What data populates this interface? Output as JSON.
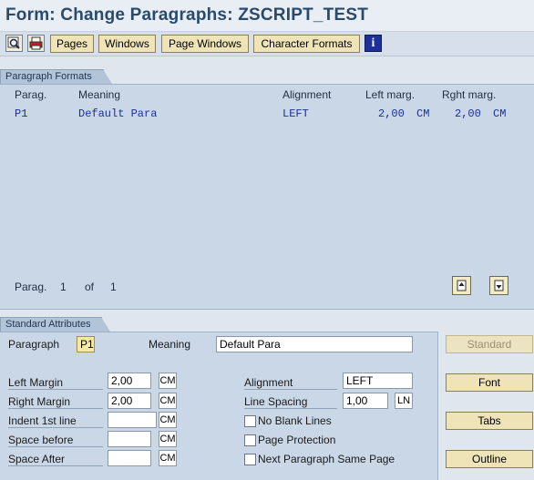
{
  "window": {
    "title": "Form: Change Paragraphs: ZSCRIPT_TEST"
  },
  "toolbar": {
    "icons": [
      "display-icon",
      "print-icon"
    ],
    "buttons": [
      "Pages",
      "Windows",
      "Page Windows",
      "Character Formats"
    ],
    "info_icon": "i"
  },
  "paragraph_formats": {
    "tab_label": "Paragraph Formats",
    "columns": [
      "Parag.",
      "Meaning",
      "Alignment",
      "Left marg.",
      "Rght marg."
    ],
    "rows": [
      {
        "parag": "P1",
        "meaning": "Default Para",
        "alignment": "LEFT",
        "left_marg": "2,00",
        "left_unit": "CM",
        "right_marg": "2,00",
        "right_unit": "CM"
      }
    ],
    "footer": {
      "label": "Parag.",
      "current": "1",
      "of_label": "of",
      "total": "1"
    }
  },
  "standard_attributes": {
    "tab_label": "Standard Attributes",
    "paragraph_label": "Paragraph",
    "paragraph_value": "P1",
    "meaning_label": "Meaning",
    "meaning_value": "Default Para",
    "left_margin_label": "Left Margin",
    "left_margin_value": "2,00",
    "left_margin_unit": "CM",
    "right_margin_label": "Right Margin",
    "right_margin_value": "2,00",
    "right_margin_unit": "CM",
    "indent_label": "Indent 1st line",
    "indent_value": "",
    "indent_unit": "CM",
    "space_before_label": "Space before",
    "space_before_value": "",
    "space_before_unit": "CM",
    "space_after_label": "Space After",
    "space_after_value": "",
    "space_after_unit": "CM",
    "alignment_label": "Alignment",
    "alignment_value": "LEFT",
    "line_spacing_label": "Line Spacing",
    "line_spacing_value": "1,00",
    "line_spacing_unit": "LN",
    "no_blank_lines_label": "No Blank Lines",
    "page_protection_label": "Page Protection",
    "next_para_same_page_label": "Next Paragraph Same Page"
  },
  "right_buttons": {
    "standard": "Standard",
    "font": "Font",
    "tabs": "Tabs",
    "outline": "Outline"
  },
  "colors": {
    "title": "#2a4a6a",
    "panel": "#cad7e6",
    "button": "#efe4b8",
    "row_text": "#1a2f9a"
  }
}
